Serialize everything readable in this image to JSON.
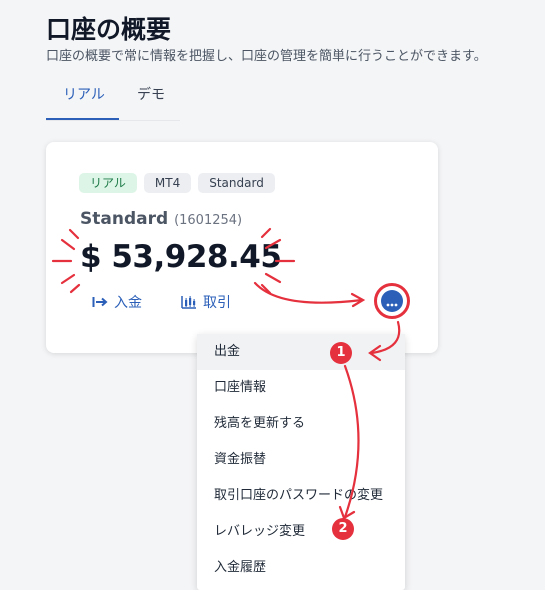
{
  "header": {
    "title": "口座の概要",
    "subtitle": "口座の概要で常に情報を把握し、口座の管理を簡単に行うことができます。"
  },
  "tabs": [
    {
      "label": "リアル",
      "active": true
    },
    {
      "label": "デモ",
      "active": false
    }
  ],
  "account_card": {
    "badges": [
      "リアル",
      "MT4",
      "Standard"
    ],
    "name": "Standard",
    "id": "(1601254)",
    "balance": "$ 53,928.45",
    "actions": {
      "deposit": "入金",
      "trade": "取引"
    }
  },
  "menu": {
    "items": [
      {
        "label": "出金",
        "active": true
      },
      {
        "label": "口座情報",
        "active": false
      },
      {
        "label": "残高を更新する",
        "active": false
      },
      {
        "label": "資金振替",
        "active": false
      },
      {
        "label": "取引口座のパスワードの変更",
        "active": false
      },
      {
        "label": "レバレッジ変更",
        "active": false
      },
      {
        "label": "入金履歴",
        "active": false
      }
    ]
  },
  "annotations": {
    "step1": "1",
    "step2": "2",
    "color": "#e5303d"
  },
  "colors": {
    "accent": "#2b5fb8",
    "badge_real_bg": "#dcf5e7",
    "badge_real_text": "#1e7a48"
  }
}
